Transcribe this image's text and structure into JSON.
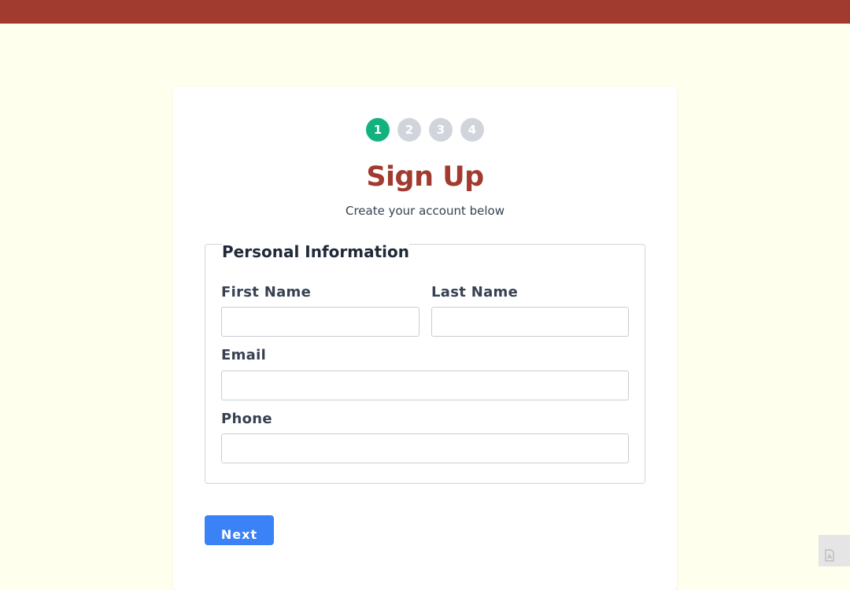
{
  "header": {
    "color": "#a23b2f"
  },
  "steps": [
    {
      "label": "1",
      "state": "active"
    },
    {
      "label": "2",
      "state": "inactive"
    },
    {
      "label": "3",
      "state": "inactive"
    },
    {
      "label": "4",
      "state": "inactive"
    }
  ],
  "form": {
    "title": "Sign Up",
    "subtitle": "Create your account below",
    "section_legend": "Personal Information",
    "fields": {
      "first_name": {
        "label": "First Name",
        "value": "",
        "placeholder": ""
      },
      "last_name": {
        "label": "Last Name",
        "value": "",
        "placeholder": ""
      },
      "email": {
        "label": "Email",
        "value": "",
        "placeholder": ""
      },
      "phone": {
        "label": "Phone",
        "value": "",
        "placeholder": ""
      }
    },
    "next_label": "Next"
  },
  "corner_widget": {
    "icon": "document-icon"
  },
  "colors": {
    "accent": "#a23b2f",
    "step_active": "#12b27f",
    "step_inactive": "#d1d5db",
    "button": "#3b82f6",
    "background": "#ffffee"
  }
}
